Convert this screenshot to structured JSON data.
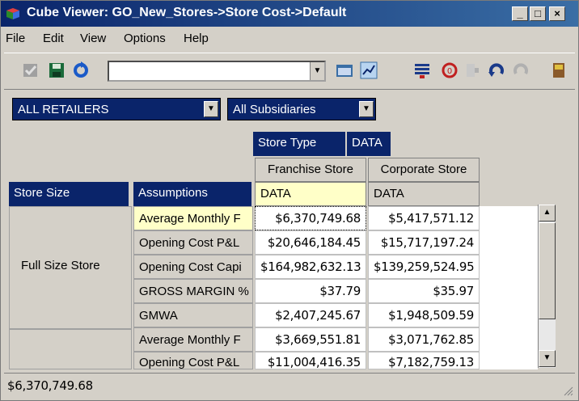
{
  "window": {
    "title": "Cube Viewer: GO_New_Stores->Store Cost->Default"
  },
  "menu": [
    {
      "key": "File",
      "label": "File"
    },
    {
      "key": "Edit",
      "label": "Edit"
    },
    {
      "key": "View",
      "label": "View"
    },
    {
      "key": "Options",
      "label": "Options"
    },
    {
      "key": "Help",
      "label": "Help"
    }
  ],
  "toolbar": {
    "view_combo_value": ""
  },
  "filters": {
    "retailer": "ALL RETAILERS",
    "subsidiary": "All Subsidiaries"
  },
  "column_dims": {
    "store_type_label": "Store Type",
    "store_type_sel": "DATA"
  },
  "columns": [
    {
      "label": "Franchise Store",
      "sub": "DATA"
    },
    {
      "label": "Corporate Store",
      "sub": "DATA"
    }
  ],
  "row_headers": {
    "store_size": "Store Size",
    "assumptions": "Assumptions"
  },
  "row_groups": [
    {
      "label": "Full Size Store"
    },
    {
      "label": ""
    }
  ],
  "rows": [
    {
      "label": "Average Monthly F",
      "franchise": "$6,370,749.68",
      "corporate": "$5,417,571.12"
    },
    {
      "label": "Opening Cost P&L",
      "franchise": "$20,646,184.45",
      "corporate": "$15,717,197.24"
    },
    {
      "label": "Opening Cost Capi",
      "franchise": "$164,982,632.13",
      "corporate": "$139,259,524.95"
    },
    {
      "label": "GROSS MARGIN %",
      "franchise": "$37.79",
      "corporate": "$35.97"
    },
    {
      "label": "GMWA",
      "franchise": "$2,407,245.67",
      "corporate": "$1,948,509.59"
    },
    {
      "label": "Average Monthly F",
      "franchise": "$3,669,551.81",
      "corporate": "$3,071,762.85"
    },
    {
      "label": "Opening Cost P&L",
      "franchise": "$11,004,416.35",
      "corporate": "$7,182,759.13"
    }
  ],
  "status": {
    "text": "$6,370,749.68"
  }
}
